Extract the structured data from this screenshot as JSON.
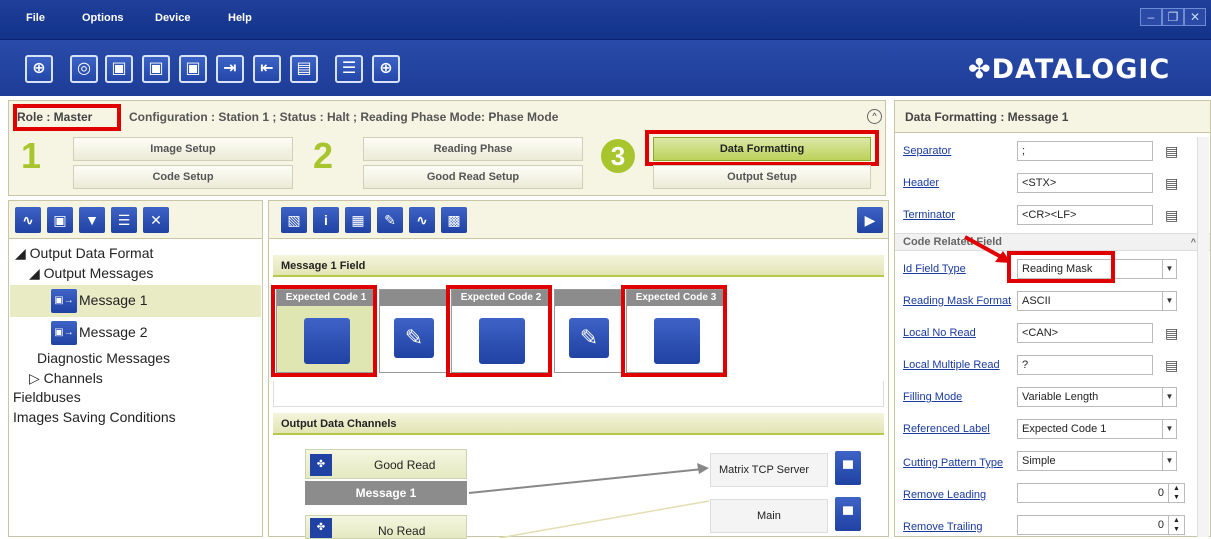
{
  "menu": [
    "File",
    "Options",
    "Device",
    "Help"
  ],
  "window_controls": [
    "–",
    "❐",
    "✕"
  ],
  "toolbar_icons": [
    "crosshair-icon",
    "teach-icon",
    "open-device-icon",
    "save-device-icon",
    "device-config-icon",
    "export-icon",
    "import-icon",
    "image-icon",
    "config-list-icon",
    "target-icon"
  ],
  "logo": "DATALOGIC",
  "config": {
    "role": "Role : Master",
    "status_line": "Configuration : Station 1 ; Status : Halt ; Reading Phase Mode: Phase Mode",
    "step1": "1",
    "step2": "2",
    "step3": "3",
    "image_setup": "Image Setup",
    "code_setup": "Code Setup",
    "reading_phase": "Reading Phase",
    "good_read_setup": "Good Read Setup",
    "data_formatting": "Data Formatting",
    "output_setup": "Output Setup"
  },
  "tree": {
    "output_data_format": "◢ Output Data Format",
    "output_messages": "◢ Output Messages",
    "message1": "Message 1",
    "message2": "Message 2",
    "diagnostic_messages": "Diagnostic Messages",
    "channels": "▷ Channels",
    "fieldbuses": "Fieldbuses",
    "images_saving": "Images Saving Conditions"
  },
  "center": {
    "message_field_title": "Message 1 Field",
    "expected_code_1": "Expected Code 1",
    "expected_code_2": "Expected Code 2",
    "expected_code_3": "Expected Code 3",
    "output_channels_title": "Output Data Channels",
    "good_read": "Good Read",
    "message1": "Message 1",
    "no_read": "No Read",
    "matrix_tcp": "Matrix TCP Server",
    "main": "Main"
  },
  "props": {
    "title": "Data Formatting : Message 1",
    "separator_label": "Separator",
    "separator_value": ";",
    "header_label": "Header",
    "header_value": "<STX>",
    "terminator_label": "Terminator",
    "terminator_value": "<CR><LF>",
    "code_related": "Code Related Field",
    "id_field_type_label": "Id Field Type",
    "id_field_type_value": "Reading Mask",
    "reading_mask_format_label": "Reading Mask Format",
    "reading_mask_format_value": "ASCII",
    "local_no_read_label": "Local No Read",
    "local_no_read_value": "<CAN>",
    "local_multiple_read_label": "Local Multiple Read",
    "local_multiple_read_value": "?",
    "filling_mode_label": "Filling Mode",
    "filling_mode_value": "Variable Length",
    "referenced_label_label": "Referenced Label",
    "referenced_label_value": "Expected Code  1",
    "cutting_pattern_label": "Cutting Pattern Type",
    "cutting_pattern_value": "Simple",
    "remove_leading_label": "Remove Leading",
    "remove_leading_value": "0",
    "remove_trailing_label": "Remove Trailing",
    "remove_trailing_value": "0"
  },
  "colors": {
    "accent_red": "#e00000",
    "step_green": "#a8c52d",
    "menubar_blue": "#1f3f9a"
  }
}
